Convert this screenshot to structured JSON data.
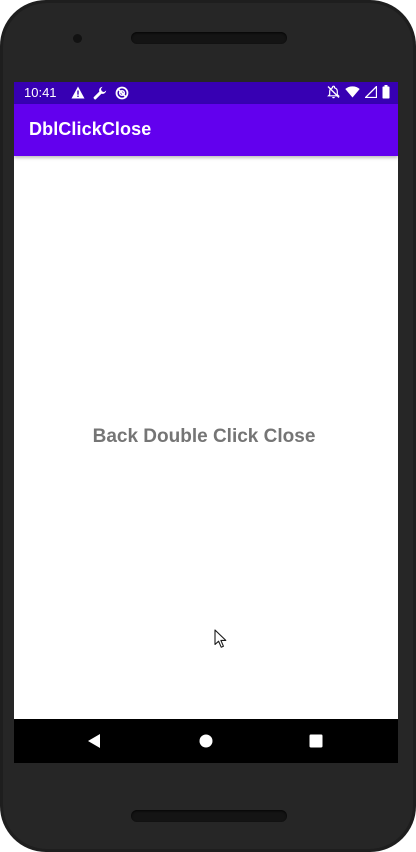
{
  "status_bar": {
    "time": "10:41",
    "left_icons": [
      "warning-icon",
      "wrench-icon",
      "sync-disabled-icon"
    ],
    "right_icons": [
      "notifications-off-icon",
      "wifi-icon",
      "cellular-signal-icon",
      "battery-icon"
    ]
  },
  "app_bar": {
    "title": "DblClickClose"
  },
  "main": {
    "message": "Back Double Click Close"
  },
  "nav_bar": {
    "buttons": [
      "back-icon",
      "home-icon",
      "recents-icon"
    ]
  },
  "colors": {
    "status_bar": "#3700b3",
    "app_bar": "#6200ee",
    "message_text": "#757575"
  }
}
